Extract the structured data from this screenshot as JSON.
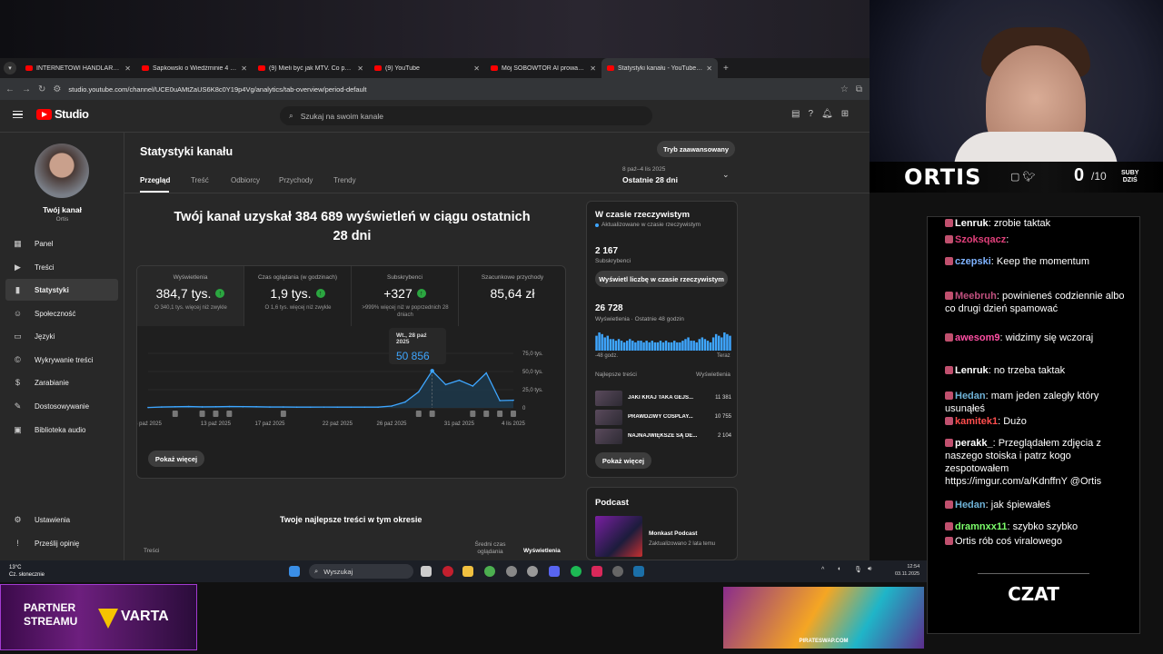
{
  "browser": {
    "tabs": [
      {
        "title": "INTERNETOWI HANDLARZE cz..."
      },
      {
        "title": "Sapkowski o Wiedźminie 4 i CD..."
      },
      {
        "title": "(9) Mieli być jak MTV. Co posz..."
      },
      {
        "title": "(9) YouTube"
      },
      {
        "title": "Mój SOBOWTÓR AI prowadzi t..."
      },
      {
        "title": "Statystyki kanału - YouTube Stu..."
      }
    ],
    "url": "studio.youtube.com/channel/UCE0uAMtZaUS6K8c0Y19p4Vg/analytics/tab-overview/period-default"
  },
  "studio": {
    "logo_text": "Studio",
    "search_placeholder": "Szukaj na swoim kanale",
    "channel_label": "Twój kanał",
    "channel_name": "Ortis",
    "nav": [
      {
        "label": "Panel",
        "icon": "dashboard-icon"
      },
      {
        "label": "Treści",
        "icon": "content-icon"
      },
      {
        "label": "Statystyki",
        "icon": "analytics-icon"
      },
      {
        "label": "Społeczność",
        "icon": "community-icon"
      },
      {
        "label": "Języki",
        "icon": "languages-icon"
      },
      {
        "label": "Wykrywanie treści",
        "icon": "content-detection-icon"
      },
      {
        "label": "Zarabianie",
        "icon": "dollar-icon"
      },
      {
        "label": "Dostosowywanie",
        "icon": "customize-icon"
      },
      {
        "label": "Biblioteka audio",
        "icon": "audio-library-icon"
      }
    ],
    "nav_bottom": [
      {
        "label": "Ustawienia",
        "icon": "gear-icon"
      },
      {
        "label": "Prześlij opinię",
        "icon": "feedback-icon"
      }
    ],
    "page_title": "Statystyki kanału",
    "advanced_btn": "Tryb zaawansowany",
    "tabs": [
      "Przegląd",
      "Treść",
      "Odbiorcy",
      "Przychody",
      "Trendy"
    ],
    "period_range": "8 paź–4 lis 2025",
    "period_label": "Ostatnie 28 dni",
    "headline_1": "Twój kanał uzyskał 384 689 wyświetleń w ciągu ostatnich",
    "headline_2": "28 dni",
    "metrics": [
      {
        "label": "Wyświetlenia",
        "value": "384,7 tys.",
        "note": "O 340,1 tys. więcej niż zwykle"
      },
      {
        "label": "Czas oglądania (w godzinach)",
        "value": "1,9 tys.",
        "note": "O 1,6 tys. więcej niż zwykle"
      },
      {
        "label": "Subskrybenci",
        "value": "+327",
        "note": ">999% więcej niż w poprzednich 28 dniach"
      },
      {
        "label": "Szacunkowe przychody",
        "value": "85,64 zł",
        "note": ""
      }
    ],
    "tooltip_date": "Wt., 28 paź 2025",
    "tooltip_value": "50 856",
    "show_more": "Pokaż więcej",
    "best_content_title": "Twoje najlepsze treści w tym okresie",
    "col_content": "Treści",
    "col_avg_1": "Średni czas",
    "col_avg_2": "oglądania",
    "col_views": "Wyświetlenia"
  },
  "chart_data": {
    "type": "area",
    "x": [
      "8 paź 2025",
      "9 paź",
      "10 paź",
      "11 paź",
      "12 paź",
      "13 paź 2025",
      "14 paź",
      "15 paź",
      "16 paź",
      "17 paź 2025",
      "18 paź",
      "19 paź",
      "20 paź",
      "21 paź",
      "22 paź 2025",
      "23 paź",
      "24 paź",
      "25 paź",
      "26 paź 2025",
      "27 paź",
      "28 paź",
      "29 paź",
      "30 paź",
      "31 paź 2025",
      "1 lis",
      "2 lis",
      "3 lis",
      "4 lis 2025"
    ],
    "values": [
      500,
      1200,
      1500,
      1800,
      1300,
      1500,
      1800,
      1700,
      1500,
      1200,
      1200,
      1000,
      1000,
      1100,
      1000,
      1000,
      1000,
      1000,
      2500,
      8000,
      22000,
      50856,
      32000,
      38000,
      30000,
      48000,
      10000,
      10500
    ],
    "xticks": [
      "8 paź 2025",
      "13 paź 2025",
      "17 paź 2025",
      "22 paź 2025",
      "26 paź 2025",
      "31 paź 2025",
      "4 lis 2025"
    ],
    "yticks": [
      "0",
      "25,0 tys.",
      "50,0 tys.",
      "75,0 tys."
    ],
    "ylim": [
      0,
      75000
    ]
  },
  "realtime": {
    "title": "W czasie rzeczywistym",
    "subtitle": "Aktualizowane w czasie rzeczywistym",
    "subs_value": "2 167",
    "subs_label": "Subskrybenci",
    "btn": "Wyświetl liczbę w czasie rzeczywistym",
    "views_value": "26 728",
    "views_label": "Wyświetlenia · Ostatnie 48 godzin",
    "bars": [
      9,
      11,
      10,
      8,
      9,
      7,
      7,
      6,
      7,
      6,
      5,
      6,
      7,
      6,
      5,
      6,
      6,
      5,
      6,
      5,
      6,
      5,
      5,
      6,
      5,
      6,
      5,
      5,
      6,
      5,
      5,
      6,
      7,
      8,
      6,
      6,
      5,
      7,
      8,
      7,
      6,
      5,
      8,
      10,
      9,
      8,
      11,
      10,
      9
    ],
    "axis_left": "-48 godz.",
    "axis_right": "Teraz",
    "top_label": "Najlepsze treści",
    "top_views_label": "Wyświetlenia",
    "top": [
      {
        "title": "JAKI KRAJ TAKA GEJS...",
        "views": "11 381"
      },
      {
        "title": "PRAWDZIWY COSPLAY...",
        "views": "10 755"
      },
      {
        "title": "NAJNAJWIĘKSZE SĄ DE...",
        "views": "2 104"
      }
    ],
    "more": "Pokaż więcej"
  },
  "podcast": {
    "title": "Podcast",
    "name": "Monkast Podcast",
    "updated": "Zaktualizowano 2 lata temu"
  },
  "taskbar": {
    "temp": "13°C",
    "weather": "Cz. słonecznie",
    "search": "Wyszukaj",
    "time": "12:54",
    "date": "03.11.2025"
  },
  "stream": {
    "streamer": "ORTIS",
    "sub_count": "0",
    "sub_goal": "/10",
    "sub_label_1": "SUBY",
    "sub_label_2": "DZIŚ",
    "chat_label": "CZAT",
    "partner_1": "PARTNER",
    "partner_2": "STREAMU",
    "sponsor": "VARTA",
    "ad_site": "PIRATESWAP.COM",
    "chat": [
      {
        "user": "Lenruk",
        "color": "#ffffff",
        "text": "zrobie taktak"
      },
      {
        "user": "Szoksqacz",
        "color": "#e0407a",
        "text": ""
      },
      {
        "user": "czepski",
        "color": "#7fb3ff",
        "text": "Keep the momentum"
      },
      {
        "user": "Meebruh",
        "color": "#c0507e",
        "text": "powinieneś codziennie albo co drugi dzień spamować"
      },
      {
        "user": "awesom9",
        "color": "#ff4fa3",
        "text": "widzimy się wczoraj"
      },
      {
        "user": "Lenruk",
        "color": "#ffffff",
        "text": "no trzeba taktak"
      },
      {
        "user": "Hedan",
        "color": "#6fb3d8",
        "text": "mam jeden zaległy który usunąłeś"
      },
      {
        "user": "kamitek1",
        "color": "#ff4d4d",
        "text": "Dużo"
      },
      {
        "user": "perakk_",
        "color": "#ffffff",
        "text": "Przeglądałem zdjęcia z naszego stoiska i patrz kogo zespotowałem https://imgur.com/a/KdnffnY @Ortis"
      },
      {
        "user": "Hedan",
        "color": "#6fb3d8",
        "text": "jak śpiewałeś"
      },
      {
        "user": "dramnxx11",
        "color": "#7cff6b",
        "text": "szybko szybko"
      },
      {
        "user": "",
        "color": "#ffffff",
        "text": "Ortis rób coś viralowego"
      }
    ]
  }
}
